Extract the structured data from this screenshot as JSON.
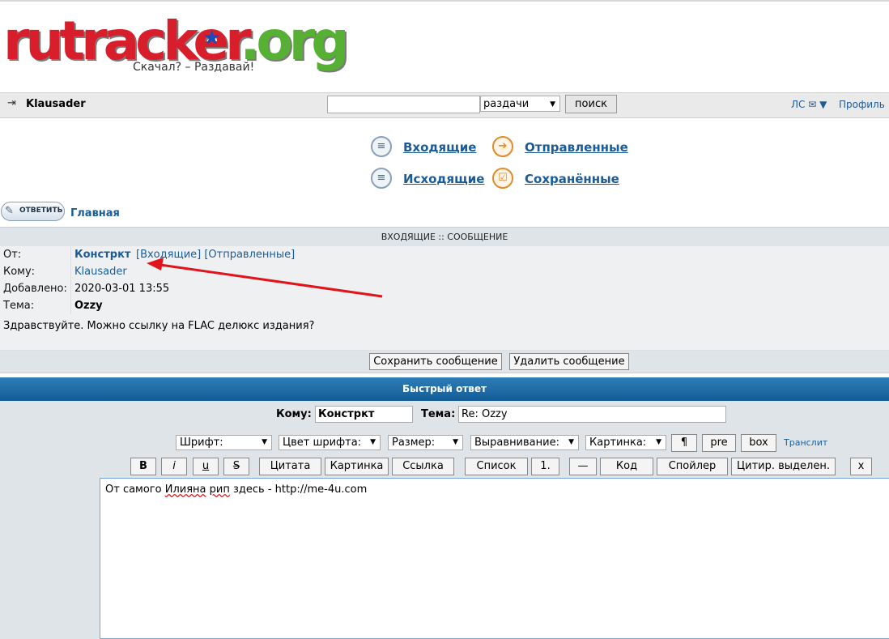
{
  "logo": {
    "word_main": "rutracker",
    "word_tld": "org",
    "tagline": "Скачал? – Раздавай!"
  },
  "navbar": {
    "username": "Klausader",
    "search_value": "",
    "search_category": "раздачи",
    "search_button": "поиск",
    "pm_label": "ЛС ✉ ▼",
    "profile_label": "Профиль"
  },
  "folders": [
    {
      "label": "Входящие",
      "icon": "inbox-icon"
    },
    {
      "label": "Отправленные",
      "icon": "sent-arrow-icon"
    },
    {
      "label": "Исходящие",
      "icon": "outbox-icon"
    },
    {
      "label": "Сохранённые",
      "icon": "saved-check-icon"
    }
  ],
  "reply_button": "ОТВЕТИТЬ",
  "breadcrumb_home": "Главная",
  "message": {
    "header": "ВХОДЯЩИЕ :: СООБЩЕНИЕ",
    "from_label": "От:",
    "from_value": "Констркт",
    "from_links": "[Входящие] [Отправленные]",
    "to_label": "Кому:",
    "to_value": "Klausader",
    "added_label": "Добавлено:",
    "added_value": "2020-03-01 13:55",
    "subject_label": "Тема:",
    "subject_value": "Ozzy",
    "body": "Здравствуйте. Можно ссылку на FLAC делюкс издания?",
    "save_button": "Сохранить сообщение",
    "delete_button": "Удалить сообщение"
  },
  "quick_reply": {
    "header": "Быстрый ответ",
    "to_label": "Кому:",
    "to_value": "Констркт",
    "subject_label": "Тема:",
    "subject_value": "Re: Ozzy",
    "selects": [
      "Шрифт:",
      "Цвет шрифта:",
      "Размер:",
      "Выравнивание:",
      "Картинка:"
    ],
    "btn_para": "¶",
    "btn_pre": "pre",
    "btn_box": "box",
    "translit": "Транслит",
    "fmt_bold": "B",
    "fmt_italic": "i",
    "fmt_underline": "u",
    "fmt_strike": "S",
    "btn_quote": "Цитата",
    "btn_image": "Картинка",
    "btn_link": "Ссылка",
    "btn_list": "Список",
    "btn_numlist": "1.",
    "btn_hr": "—",
    "btn_code": "Код",
    "btn_spoiler": "Спойлер",
    "btn_quote_sel": "Цитир. выделен.",
    "btn_close": "x",
    "editor_pre": "От самого ",
    "editor_word1": "Илияна",
    "editor_space": " ",
    "editor_word2": "рип",
    "editor_post": " здесь - http://me-4u.com"
  },
  "annotation": {
    "color": "#e0141a"
  }
}
